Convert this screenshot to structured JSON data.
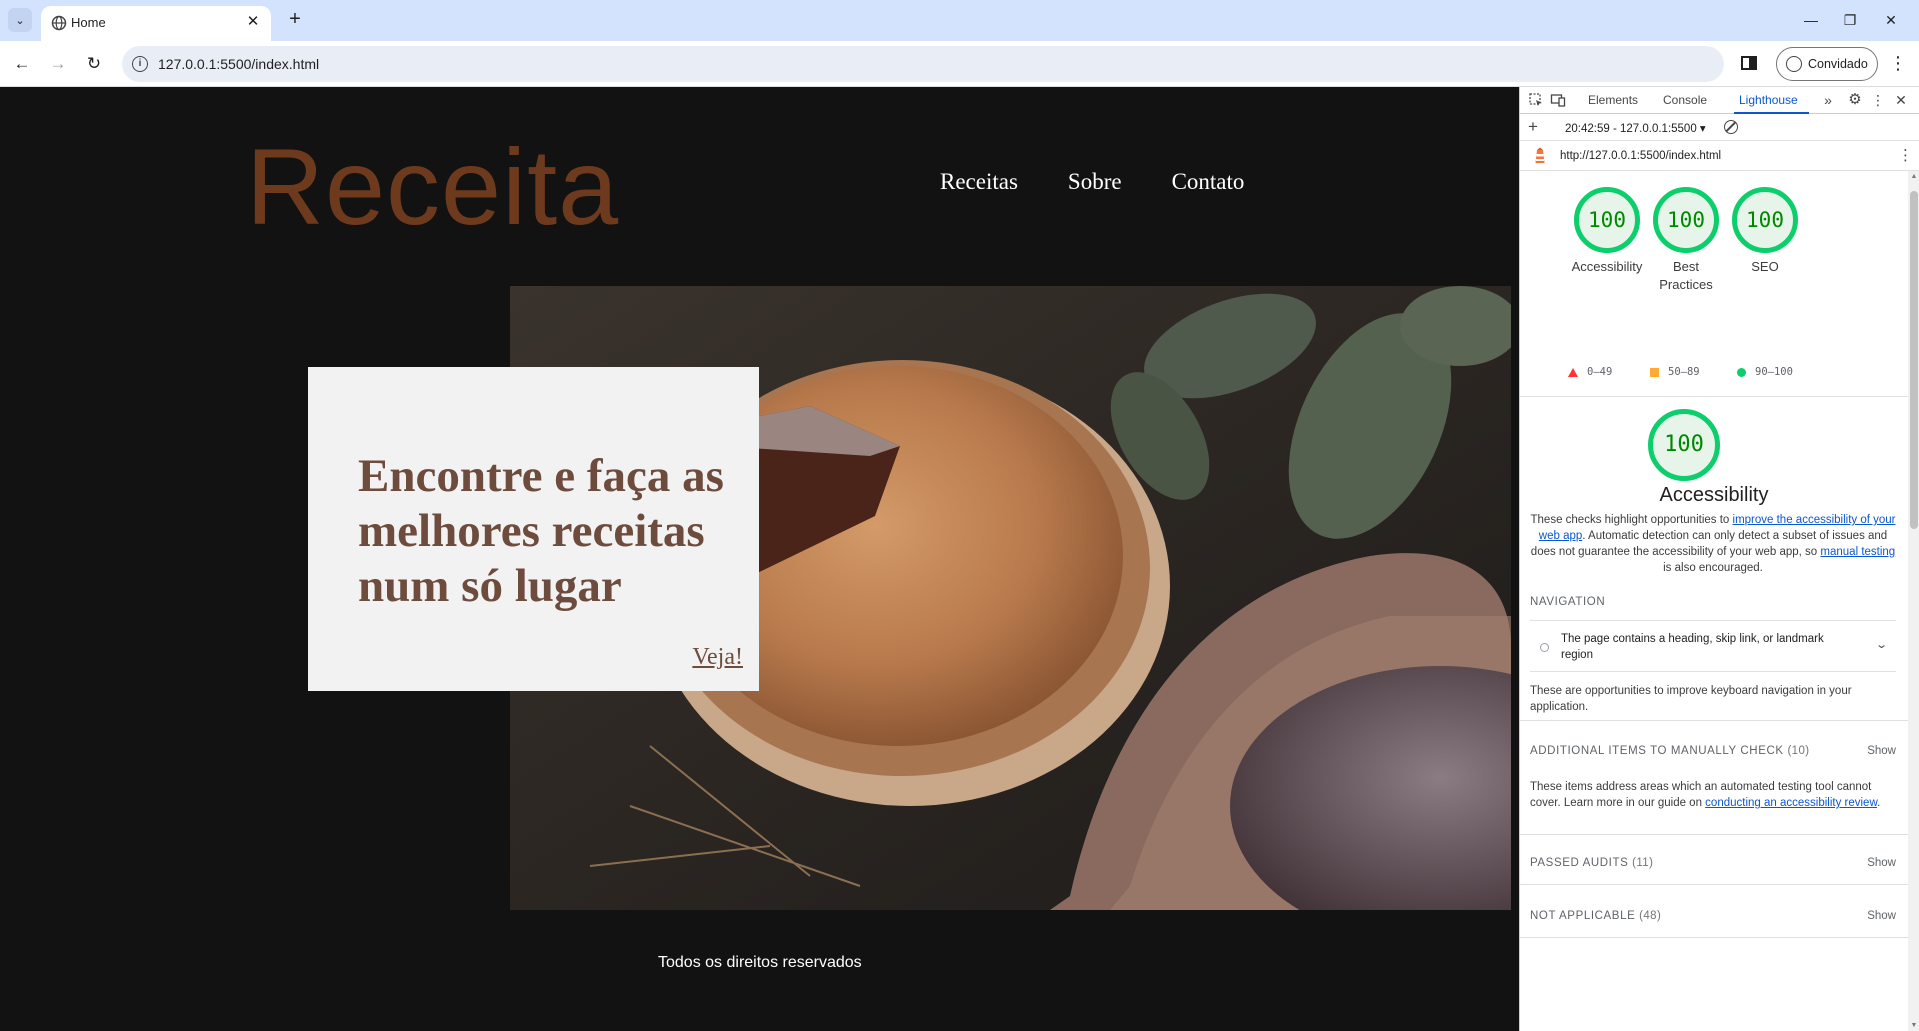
{
  "browser": {
    "tab_title": "Home",
    "url": "127.0.0.1:5500/index.html",
    "profile_label": "Convidado"
  },
  "site": {
    "logo": "Receita",
    "nav": [
      "Receitas",
      "Sobre",
      "Contato"
    ],
    "hero_headline": "Encontre e faça as melhores receitas num só lugar",
    "hero_cta": "Veja!",
    "footer": "Todos os direitos reservados"
  },
  "devtools": {
    "tabs": [
      "Elements",
      "Console",
      "Lighthouse"
    ],
    "active_tab": "Lighthouse",
    "report_selector": "20:42:59 - 127.0.0.1:5500 ▾",
    "audited_url": "http://127.0.0.1:5500/index.html",
    "scores": [
      {
        "label_line1": "Accessibility",
        "label_line2": "",
        "score": "100"
      },
      {
        "label_line1": "Best",
        "label_line2": "Practices",
        "score": "100"
      },
      {
        "label_line1": "SEO",
        "label_line2": "",
        "score": "100"
      }
    ],
    "legend": [
      {
        "range": "0–49",
        "color": "#ff3333",
        "shape": "triangle"
      },
      {
        "range": "50–89",
        "color": "#ffaa33",
        "shape": "square"
      },
      {
        "range": "90–100",
        "color": "#0cce6b",
        "shape": "circle"
      }
    ],
    "category": {
      "score": "100",
      "title": "Accessibility",
      "desc_before": "These checks highlight opportunities to ",
      "desc_link1": "improve the accessibility of your web app",
      "desc_mid": ". Automatic detection can only detect a subset of issues and does not guarantee the accessibility of your web app, so ",
      "desc_link2": "manual testing",
      "desc_after": " is also encouraged."
    },
    "navigation": {
      "heading": "NAVIGATION",
      "audit_text": "The page contains a heading, skip link, or landmark region",
      "note": "These are opportunities to improve keyboard navigation in your application."
    },
    "manual": {
      "heading": "ADDITIONAL ITEMS TO MANUALLY CHECK",
      "count": "(10)",
      "show": "Show",
      "desc_before": "These items address areas which an automated testing tool cannot cover. Learn more in our guide on ",
      "desc_link": "conducting an accessibility review",
      "desc_after": "."
    },
    "passed": {
      "heading": "PASSED AUDITS",
      "count": "(11)",
      "show": "Show"
    },
    "not_applicable": {
      "heading": "NOT APPLICABLE",
      "count": "(48)",
      "show": "Show"
    }
  },
  "colors": {
    "page_bg": "#121212",
    "logo": "#6e3a1e",
    "card_bg": "#f3f2f2",
    "card_text": "#6d4c3d",
    "score_green": "#0cce6b",
    "devtools_accent": "#0b57d0"
  }
}
